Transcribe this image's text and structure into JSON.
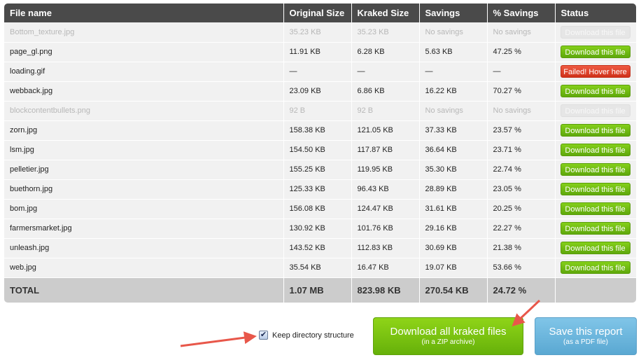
{
  "table": {
    "headers": [
      "File name",
      "Original Size",
      "Kraked Size",
      "Savings",
      "% Savings",
      "Status"
    ],
    "rows": [
      {
        "name": "Bottom_texture.jpg",
        "original": "35.23 KB",
        "kraked": "35.23 KB",
        "savings": "No savings",
        "pct": "No savings",
        "status": "Download this file",
        "state": "disabled"
      },
      {
        "name": "page_gl.png",
        "original": "11.91 KB",
        "kraked": "6.28 KB",
        "savings": "5.63 KB",
        "pct": "47.25 %",
        "status": "Download this file",
        "state": "ok"
      },
      {
        "name": "loading.gif",
        "original": "—",
        "kraked": "—",
        "savings": "—",
        "pct": "—",
        "status": "Failed! Hover here",
        "state": "failed"
      },
      {
        "name": "webback.jpg",
        "original": "23.09 KB",
        "kraked": "6.86 KB",
        "savings": "16.22 KB",
        "pct": "70.27 %",
        "status": "Download this file",
        "state": "ok"
      },
      {
        "name": "blockcontentbullets.png",
        "original": "92 B",
        "kraked": "92 B",
        "savings": "No savings",
        "pct": "No savings",
        "status": "Download this file",
        "state": "disabled"
      },
      {
        "name": "zorn.jpg",
        "original": "158.38 KB",
        "kraked": "121.05 KB",
        "savings": "37.33 KB",
        "pct": "23.57 %",
        "status": "Download this file",
        "state": "ok"
      },
      {
        "name": "lsm.jpg",
        "original": "154.50 KB",
        "kraked": "117.87 KB",
        "savings": "36.64 KB",
        "pct": "23.71 %",
        "status": "Download this file",
        "state": "ok"
      },
      {
        "name": "pelletier.jpg",
        "original": "155.25 KB",
        "kraked": "119.95 KB",
        "savings": "35.30 KB",
        "pct": "22.74 %",
        "status": "Download this file",
        "state": "ok"
      },
      {
        "name": "buethorn.jpg",
        "original": "125.33 KB",
        "kraked": "96.43 KB",
        "savings": "28.89 KB",
        "pct": "23.05 %",
        "status": "Download this file",
        "state": "ok"
      },
      {
        "name": "bom.jpg",
        "original": "156.08 KB",
        "kraked": "124.47 KB",
        "savings": "31.61 KB",
        "pct": "20.25 %",
        "status": "Download this file",
        "state": "ok"
      },
      {
        "name": "farmersmarket.jpg",
        "original": "130.92 KB",
        "kraked": "101.76 KB",
        "savings": "29.16 KB",
        "pct": "22.27 %",
        "status": "Download this file",
        "state": "ok"
      },
      {
        "name": "unleash.jpg",
        "original": "143.52 KB",
        "kraked": "112.83 KB",
        "savings": "30.69 KB",
        "pct": "21.38 %",
        "status": "Download this file",
        "state": "ok"
      },
      {
        "name": "web.jpg",
        "original": "35.54 KB",
        "kraked": "16.47 KB",
        "savings": "19.07 KB",
        "pct": "53.66 %",
        "status": "Download this file",
        "state": "ok"
      }
    ],
    "total": {
      "label": "TOTAL",
      "original": "1.07 MB",
      "kraked": "823.98 KB",
      "savings": "270.54 KB",
      "pct": "24.72 %"
    }
  },
  "options": {
    "keep_directory_label": "Keep directory structure",
    "keep_directory_checked": true
  },
  "actions": {
    "download_all_label": "Download all kraked files",
    "download_all_sub": "(in a ZIP archive)",
    "save_report_label": "Save this report",
    "save_report_sub": "(as a PDF file)"
  },
  "colors": {
    "header_bg": "#4a4a4a",
    "row_bg": "#f1f1f1",
    "total_bg": "#cccccc",
    "ok_green": "#6cb80f",
    "fail_red": "#dc4128",
    "save_blue": "#6ab4de",
    "annotation_arrow": "#e8574a"
  },
  "icons": {
    "checkbox": "checkmark-icon",
    "annotation": "arrow-annotation"
  }
}
